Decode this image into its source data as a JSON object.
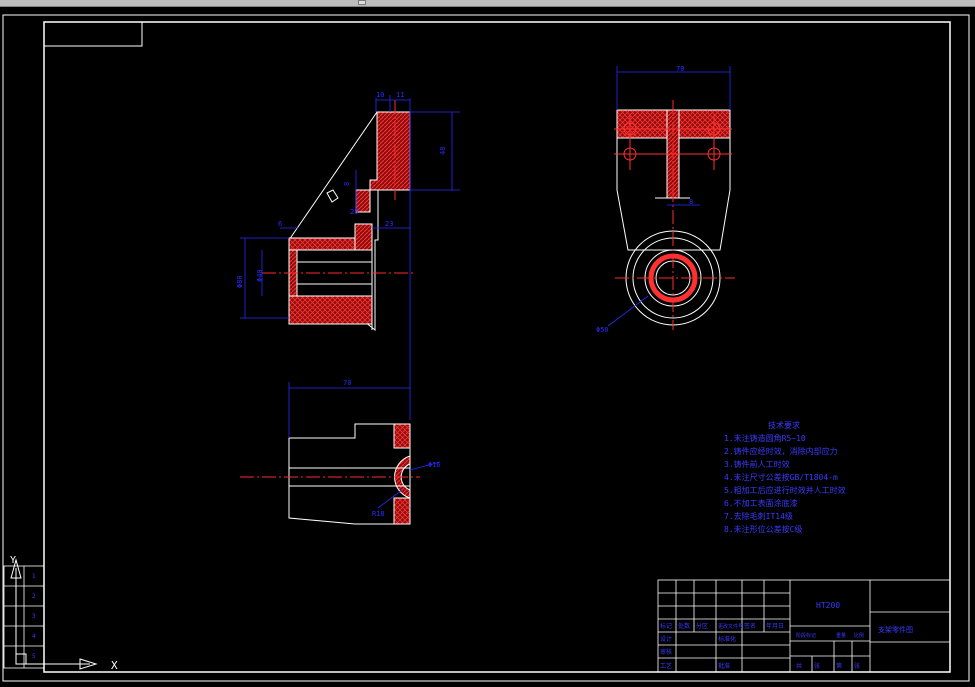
{
  "window": {
    "background": "#000000",
    "toolbar_color": "#bdbdbd"
  },
  "colors": {
    "outline": "#ffffff",
    "dimension": "#0000ff",
    "section_hatch": "#ff2a2a",
    "centerline": "#ff2a2a",
    "notes_text": "#3a3aff",
    "title_block": "#ffffff"
  },
  "views": {
    "front_section": {
      "dims": [
        "10",
        "11",
        "48",
        "8",
        "23",
        "25",
        "6",
        "Φ80",
        "Φ40"
      ]
    },
    "side_view": {
      "dims": [
        "70",
        "8",
        "Φ50"
      ]
    },
    "top_view": {
      "dims": [
        "70",
        "Φ16",
        "R18"
      ]
    }
  },
  "tech_notes": {
    "title": "技术要求",
    "items": [
      "1.未注铸造圆角R5~10",
      "2.铸件应经时效，消除内部应力",
      "3.铸件前人工时效",
      "4.未注尺寸公差按GB/T1804-m",
      "5.粗加工后应进行时效并人工时效",
      "6.不加工表面涂底漆",
      "7.去除毛刺IT14级",
      "8.未注形位公差按C级"
    ]
  },
  "title_block": {
    "part_name": "支架零件图",
    "material": "HT200",
    "labels": [
      "标记",
      "处数",
      "分区",
      "更改文件号",
      "签名",
      "年月日",
      "设计",
      "标准化",
      "审核",
      "工艺",
      "批准",
      "阶段标记",
      "重量",
      "比例",
      "共",
      "张",
      "第",
      "张"
    ]
  },
  "left_table": {
    "rows": [
      "1",
      "2",
      "3",
      "4",
      "5"
    ]
  },
  "ucs": {
    "y_label": "Y",
    "x_label": "X"
  }
}
